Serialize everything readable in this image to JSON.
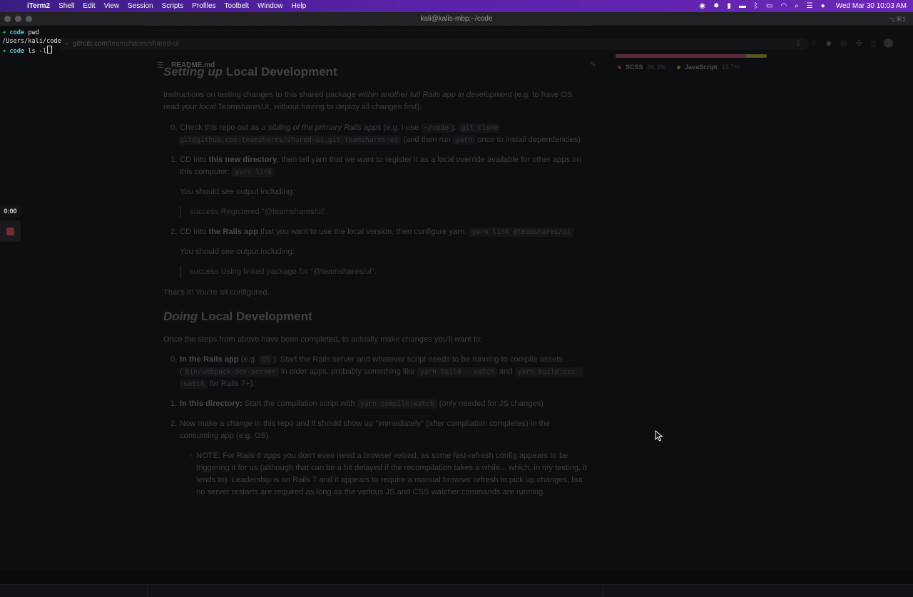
{
  "menubar": {
    "apple_icon": "apple-icon",
    "items": [
      "iTerm2",
      "Shell",
      "Edit",
      "View",
      "Session",
      "Scripts",
      "Profiles",
      "Toolbelt",
      "Window",
      "Help"
    ],
    "clock": "Wed Mar 30  10:03 AM"
  },
  "window": {
    "title": "kali@kalis-mbp:~/code",
    "shortcut": "⌥⌘1"
  },
  "terminal": {
    "lines": [
      {
        "prompt": "➜",
        "dir": "code",
        "cmd": "pwd"
      },
      {
        "output": "/Users/kali/code"
      },
      {
        "prompt": "➜",
        "dir": "code",
        "cmd": "ls -l"
      }
    ]
  },
  "browser": {
    "url_host": "github.com",
    "url_path": "/teamshares/shared-ui",
    "readme_title": "README.md",
    "languages": [
      {
        "name": "SCSS",
        "percent": "86.3%",
        "fraction": 0.863,
        "color": "#5b2b3c"
      },
      {
        "name": "JavaScript",
        "percent": "13.7%",
        "fraction": 0.137,
        "color": "#54551f"
      }
    ]
  },
  "readme": {
    "h1_em": "Setting up",
    "h1_rest": " Local Development",
    "intro_a": "Instructions on testing changes to this shared package ",
    "intro_em": "within another full Rails app in development",
    "intro_b": " (e.g. to have OS read your ",
    "intro_local": "local",
    "intro_c": " TeamsharesUI, without having to deploy all changes first).",
    "step0_num": "0.",
    "step0_a": "Check this repo out as ",
    "step0_em": "a sibling of the primary Rails apps",
    "step0_b": " (e.g. I use ",
    "step0_code1": "~/code",
    "step0_c": "): ",
    "step0_code2": "git clone git@github.com:teamshares/shared-ui.git teamshares-ui",
    "step0_d": " (and then run ",
    "step0_code3": "yarn",
    "step0_e": " once to install dependencies)",
    "step1_num": "1.",
    "step1_a": "CD into ",
    "step1_strong": "this new directory",
    "step1_b": ", then tell yarn that we want to register it as a local override available for other apps on this computer: ",
    "step1_code": "yarn link",
    "step1_output_label": "You should see output including:",
    "step1_output": "success Registered \"@teamshares/ui\".",
    "step2_num": "2.",
    "step2_a": "CD into ",
    "step2_strong": "the Rails app",
    "step2_b": " that you want to use the local version, then configure yarn: ",
    "step2_code": "yarn link @teamshares/ui",
    "step2_output_label": "You should see output including:",
    "step2_output": "success Using linked package for \"@teamshares/ui\".",
    "done": "That's it! You're all configured.",
    "h2_em": "Doing",
    "h2_rest": " Local Development",
    "once": "Once the steps from above have been completed, to actually make changes you'll want to:",
    "d0_num": "0.",
    "d0_strong": "In the Rails app",
    "d0_a": " (e.g. ",
    "d0_code1": "OS",
    "d0_b": "): Start the Rails server and whatever script needs to be running to compile assets (",
    "d0_code2": "bin/webpack-dev-server",
    "d0_c": " in older apps, probably something like ",
    "d0_code3": "yarn build --watch",
    "d0_d": " and ",
    "d0_code4": "yarn build:css --watch",
    "d0_e": " for Rails 7+).",
    "d1_num": "1.",
    "d1_strong": "In this directory:",
    "d1_a": " Start the compilation script with ",
    "d1_code": "yarn compile:watch",
    "d1_b": " (only needed for JS changes)",
    "d2_num": "2.",
    "d2_text": "Now make a change in this repo and it should show up \"immediately\" (after compilation completes) in the consuming app (e.g. OS).",
    "note_bullet": "◦",
    "note": "NOTE: For Rails 6 apps you don't even need a browser reload, as some fast-refresh config appears to be triggering it for us (although that can be a bit delayed if the recompilation takes a while... which, in my testing, it tends to). Leadership is on Rails 7 and it appears to require a manual browser refresh to pick up changes, but no server restarts are required as long as the various JS and CSS watcher commands are running."
  },
  "recorder": {
    "time": "0:00"
  }
}
